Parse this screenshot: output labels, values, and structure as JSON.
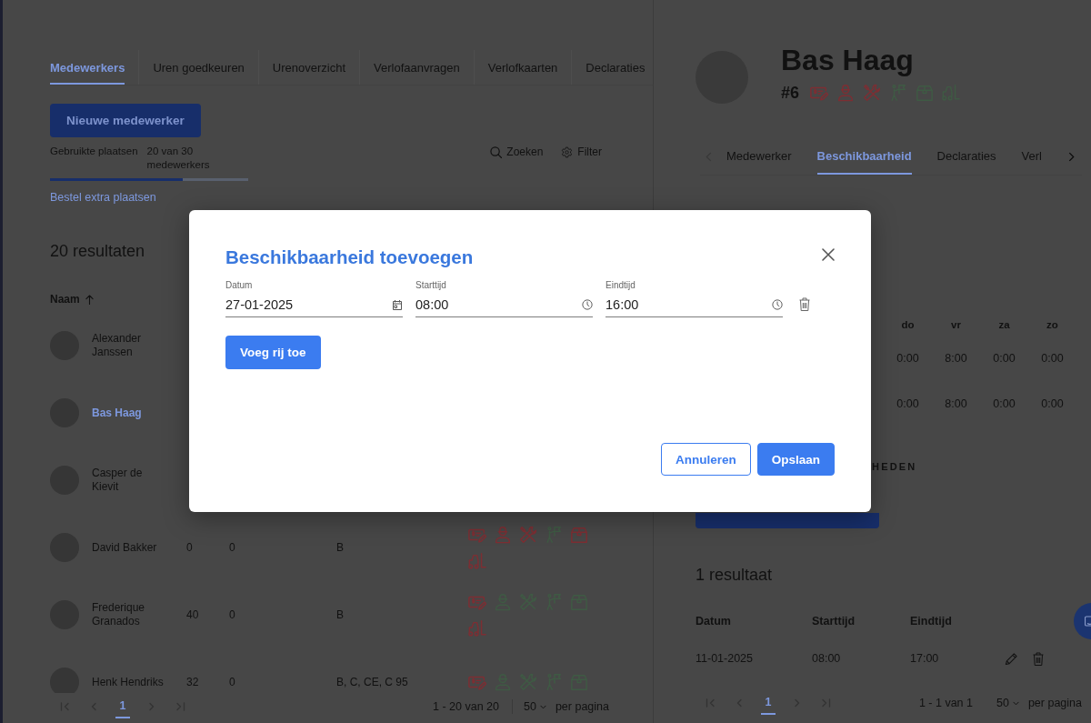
{
  "left_panel": {
    "tabs": [
      {
        "label": "Medewerkers",
        "selected": true
      },
      {
        "label": "Uren goedkeuren",
        "selected": false
      },
      {
        "label": "Urenoverzicht",
        "selected": false
      },
      {
        "label": "Verlofaanvragen",
        "selected": false
      },
      {
        "label": "Verlofkaarten",
        "selected": false
      },
      {
        "label": "Declaraties",
        "selected": false
      }
    ],
    "new_button": "Nieuwe medewerker",
    "usage": {
      "label": "Gebruikte plaatsen",
      "value": "20 van 30 medewerkers",
      "level": 0.67
    },
    "order_link": "Bestel extra plaatsen",
    "search": "Zoeken",
    "filter": "Filter",
    "result_count": "20 resultaten",
    "table": {
      "columns": [
        {
          "label": "Naam",
          "sorted": true
        }
      ],
      "rows": [
        {
          "name": "Alexander Janssen",
          "selected": false
        },
        {
          "name": "Bas Haag",
          "selected": true
        },
        {
          "name": "Casper de Kievit",
          "selected": false
        },
        {
          "name": "David Bakker",
          "selected": false,
          "cells": [
            "0",
            "0",
            "B"
          ],
          "icons": [
            {
              "kind": "card",
              "color": "#7d2e33"
            },
            {
              "kind": "person",
              "color": "#7d2e33"
            },
            {
              "kind": "tools",
              "color": "#7d2e33"
            },
            {
              "kind": "flag",
              "color": "#3f5a44"
            },
            {
              "kind": "box",
              "color": "#7d2e33"
            },
            {
              "kind": "forklift",
              "color": "#7d2e33"
            }
          ]
        },
        {
          "name": "Frederique Granados",
          "selected": false,
          "cells": [
            "40",
            "0",
            "B"
          ],
          "icons": [
            {
              "kind": "card",
              "color": "#7d2e33"
            },
            {
              "kind": "person",
              "color": "#3f5a44"
            },
            {
              "kind": "tools",
              "color": "#3f5a44"
            },
            {
              "kind": "flag",
              "color": "#3f5a44"
            },
            {
              "kind": "box",
              "color": "#3f5a44"
            },
            {
              "kind": "forklift",
              "color": "#7d2e33"
            }
          ]
        },
        {
          "name": "Henk Hendriks",
          "selected": false,
          "cells": [
            "32",
            "0",
            "B, C, CE, C 95"
          ],
          "icons": [
            {
              "kind": "card",
              "color": "#7d2e33"
            },
            {
              "kind": "person",
              "color": "#3f5a44"
            },
            {
              "kind": "tools",
              "color": "#3f5a44"
            },
            {
              "kind": "flag",
              "color": "#3f5a44"
            },
            {
              "kind": "box",
              "color": "#3f5a44"
            }
          ]
        }
      ]
    },
    "pagination": {
      "nav_disabled": true,
      "pages": [
        {
          "label": "1",
          "selected": true
        }
      ],
      "range": "1 - 20 van 20",
      "page_size": "50",
      "per_page": "per pagina"
    }
  },
  "right_panel": {
    "employee": {
      "name": "Bas Haag",
      "number": "#6",
      "icons": [
        {
          "kind": "card",
          "color": "#7d2e33"
        },
        {
          "kind": "person",
          "color": "#7d2e33"
        },
        {
          "kind": "tools",
          "color": "#7d2e33"
        },
        {
          "kind": "flag",
          "color": "#3f5a44"
        },
        {
          "kind": "box",
          "color": "#3f5a44"
        },
        {
          "kind": "forklift",
          "color": "#3f5a44"
        }
      ]
    },
    "tabs": [
      {
        "label": "Medewerker",
        "selected": false
      },
      {
        "label": "Beschikbaarheid",
        "selected": true
      },
      {
        "label": "Declaraties",
        "selected": false
      },
      {
        "label": "Verl",
        "selected": false
      }
    ],
    "scroll_left_disabled": true,
    "scroll_right_disabled": false,
    "week_table": {
      "columns": [
        "do",
        "vr",
        "za",
        "zo"
      ],
      "rows": [
        [
          "0:00",
          "8:00",
          "0:00",
          "0:00"
        ],
        [
          "0:00",
          "8:00",
          "0:00",
          "0:00"
        ]
      ]
    },
    "section_heading": "HEDEN",
    "result_count": "1 resultaat",
    "table": {
      "columns": [
        "Datum",
        "Starttijd",
        "Eindtijd"
      ],
      "rows": [
        [
          "11-01-2025",
          "08:00",
          "17:00"
        ]
      ]
    },
    "pagination": {
      "nav_disabled": true,
      "pages": [
        {
          "label": "1",
          "selected": true
        }
      ],
      "range": "1 - 1 van 1",
      "page_size": "50",
      "per_page": "per pagina"
    }
  },
  "modal": {
    "title": "Beschikbaarheid toevoegen",
    "rows": [
      {
        "fields": [
          {
            "label": "Datum",
            "value": "27-01-2025",
            "kind": "date"
          },
          {
            "label": "Starttijd",
            "value": "08:00",
            "kind": "time"
          },
          {
            "label": "Eindtijd",
            "value": "16:00",
            "kind": "time"
          }
        ]
      }
    ],
    "add_row_button": "Voeg rij toe",
    "buttons": [
      {
        "label": "Annuleren",
        "kind": "secondary"
      },
      {
        "label": "Opslaan",
        "kind": "primary"
      }
    ]
  }
}
